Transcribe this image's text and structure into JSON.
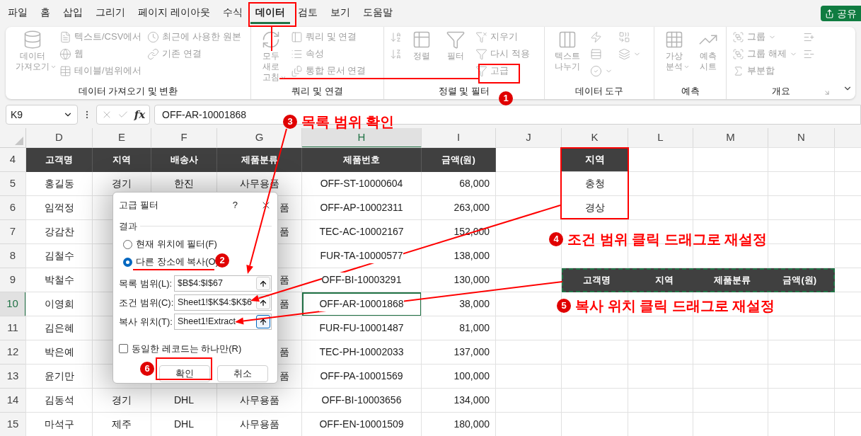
{
  "tabs": [
    {
      "label": "파일",
      "selected": false
    },
    {
      "label": "홈",
      "selected": false
    },
    {
      "label": "삽입",
      "selected": false
    },
    {
      "label": "그리기",
      "selected": false
    },
    {
      "label": "페이지 레이아웃",
      "selected": false
    },
    {
      "label": "수식",
      "selected": false
    },
    {
      "label": "데이터",
      "selected": true
    },
    {
      "label": "검토",
      "selected": false
    },
    {
      "label": "보기",
      "selected": false
    },
    {
      "label": "도움말",
      "selected": false
    }
  ],
  "share_button": "공유",
  "ribbon": {
    "disabled": true,
    "groups": [
      {
        "label": "데이터 가져오기 및 변환",
        "items": [
          {
            "kind": "large",
            "label": "데이터 가져오기",
            "has_menu": true
          },
          {
            "kind": "small",
            "label": "텍스트/CSV에서",
            "has_menu": false
          },
          {
            "kind": "small",
            "label": "웹",
            "has_menu": false
          },
          {
            "kind": "small",
            "label": "테이블/범위에서",
            "has_menu": false
          },
          {
            "kind": "small",
            "label": "최근에 사용한 원본",
            "has_menu": false
          },
          {
            "kind": "small",
            "label": "기존 연결",
            "has_menu": false
          }
        ]
      },
      {
        "label": "쿼리 및 연결",
        "items": [
          {
            "kind": "large",
            "label": "모두 새로 고침",
            "has_menu": true
          },
          {
            "kind": "small",
            "label": "쿼리 및 연결",
            "has_menu": false
          },
          {
            "kind": "small",
            "label": "속성",
            "has_menu": false
          },
          {
            "kind": "small",
            "label": "통합 문서 연결",
            "has_menu": false
          }
        ]
      },
      {
        "label": "정렬 및 필터",
        "items": [
          {
            "kind": "icon",
            "has_menu": false
          },
          {
            "kind": "icon",
            "has_menu": false
          },
          {
            "kind": "large",
            "label": "정렬",
            "has_menu": false
          },
          {
            "kind": "large",
            "label": "필터",
            "has_menu": false
          },
          {
            "kind": "small",
            "label": "지우기",
            "has_menu": false
          },
          {
            "kind": "small",
            "label": "다시 적용",
            "has_menu": false
          },
          {
            "kind": "small",
            "label": "고급",
            "has_menu": false
          }
        ]
      },
      {
        "label": "데이터 도구",
        "items": [
          {
            "kind": "large",
            "label": "텍스트 나누기",
            "has_menu": false
          },
          {
            "kind": "icon",
            "has_menu": false
          },
          {
            "kind": "icon",
            "has_menu": false
          },
          {
            "kind": "icon",
            "has_menu": true
          },
          {
            "kind": "icon",
            "has_menu": false
          },
          {
            "kind": "icon",
            "has_menu": true
          }
        ]
      },
      {
        "label": "예측",
        "items": [
          {
            "kind": "large",
            "label": "가상 분석",
            "has_menu": true
          },
          {
            "kind": "large",
            "label": "예측 시트",
            "has_menu": false
          }
        ]
      },
      {
        "label": "개요",
        "items": [
          {
            "kind": "small",
            "label": "그룹",
            "has_menu": true
          },
          {
            "kind": "small",
            "label": "그룹 해제",
            "has_menu": true
          },
          {
            "kind": "small",
            "label": "부분합",
            "has_menu": false
          },
          {
            "kind": "icon",
            "has_menu": false
          },
          {
            "kind": "icon",
            "has_menu": false
          }
        ]
      }
    ]
  },
  "formula_bar": {
    "name_box": "K9",
    "function_label": "fx",
    "value": "OFF-AR-10001868"
  },
  "columns": [
    {
      "label": "D",
      "selected": false
    },
    {
      "label": "E",
      "selected": false
    },
    {
      "label": "F",
      "selected": false
    },
    {
      "label": "G",
      "selected": false
    },
    {
      "label": "H",
      "selected": true
    },
    {
      "label": "I",
      "selected": false
    },
    {
      "label": "J",
      "selected": false
    },
    {
      "label": "K",
      "selected": false
    },
    {
      "label": "L",
      "selected": false
    },
    {
      "label": "M",
      "selected": false
    },
    {
      "label": "N",
      "selected": false
    }
  ],
  "row_numbers": [
    {
      "label": "4",
      "selected": false
    },
    {
      "label": "5",
      "selected": false
    },
    {
      "label": "6",
      "selected": false
    },
    {
      "label": "7",
      "selected": false
    },
    {
      "label": "8",
      "selected": false
    },
    {
      "label": "9",
      "selected": false
    },
    {
      "label": "10",
      "selected": true
    },
    {
      "label": "11",
      "selected": false
    },
    {
      "label": "12",
      "selected": false
    },
    {
      "label": "13",
      "selected": false
    },
    {
      "label": "14",
      "selected": false
    },
    {
      "label": "15",
      "selected": false
    }
  ],
  "table": {
    "headers": [
      "고객명",
      "지역",
      "배송사",
      "제품분류",
      "제품번호",
      "금액(원)"
    ],
    "rows": [
      {
        "kind": "full",
        "cells": [
          "홍길동",
          "경기",
          "한진",
          "사무용품",
          "OFF-ST-10000604",
          "68,000"
        ],
        "active": false
      },
      {
        "kind": "covered",
        "cells": [
          "임꺽정",
          "품",
          "OFF-AP-10002311",
          "263,000"
        ],
        "active": false
      },
      {
        "kind": "covered",
        "cells": [
          "강감찬",
          "품",
          "TEC-AC-10002167",
          "152,000"
        ],
        "active": false
      },
      {
        "kind": "hidden",
        "cells": [
          "김철수",
          "FUR-TA-10000577",
          "138,000"
        ],
        "active": false
      },
      {
        "kind": "covered",
        "cells": [
          "박철수",
          "품",
          "OFF-BI-10003291",
          "130,000"
        ],
        "active": false
      },
      {
        "kind": "covered",
        "cells": [
          "이영희",
          "품",
          "OFF-AR-10001868",
          "38,000"
        ],
        "active": true
      },
      {
        "kind": "hidden",
        "cells": [
          "김은혜",
          "FUR-FU-10001487",
          "81,000"
        ],
        "active": false
      },
      {
        "kind": "covered",
        "cells": [
          "박은예",
          "품",
          "TEC-PH-10002033",
          "137,000"
        ],
        "active": false
      },
      {
        "kind": "covered",
        "cells": [
          "윤기만",
          "품",
          "OFF-PA-10001569",
          "100,000"
        ],
        "active": false
      },
      {
        "kind": "full",
        "cells": [
          "김동석",
          "경기",
          "DHL",
          "사무용품",
          "OFF-BI-10003656",
          "134,000"
        ],
        "active": false
      },
      {
        "kind": "full",
        "cells": [
          "마석구",
          "제주",
          "DHL",
          "사무용품",
          "OFF-EN-10001509",
          "180,000"
        ],
        "active": false
      }
    ]
  },
  "criteria": {
    "header": "지역",
    "values": [
      "충청",
      "경상"
    ]
  },
  "extract_header": [
    "고객명",
    "지역",
    "제품분류",
    "금액(원)"
  ],
  "dialog": {
    "title": "고급 필터",
    "help": "?",
    "section": "결과",
    "options": [
      {
        "label": "현재 위치에 필터(F)",
        "selected": false
      },
      {
        "label": "다른 장소에 복사(O)",
        "selected": true
      }
    ],
    "fields": [
      {
        "label": "목록 범위(L):",
        "value": "$B$4:$I$67",
        "focused": false
      },
      {
        "label": "조건 범위(C):",
        "value": "Sheet1!$K$4:$K$6",
        "focused": false
      },
      {
        "label": "복사 위치(T):",
        "value": "Sheet1!Extract",
        "focused": true
      }
    ],
    "checkbox": {
      "label": "동일한 레코드는 하나만(R)",
      "checked": false
    },
    "buttons": [
      "확인",
      "취소"
    ]
  },
  "annotations": [
    {
      "number": "1"
    },
    {
      "number": "2"
    },
    {
      "number": "3",
      "text": "목록 범위 확인"
    },
    {
      "number": "4",
      "text": "조건 범위 클릭 드래그로 재설정"
    },
    {
      "number": "5",
      "text": "복사 위치 클릭 드래그로 재설정"
    },
    {
      "number": "6"
    }
  ]
}
